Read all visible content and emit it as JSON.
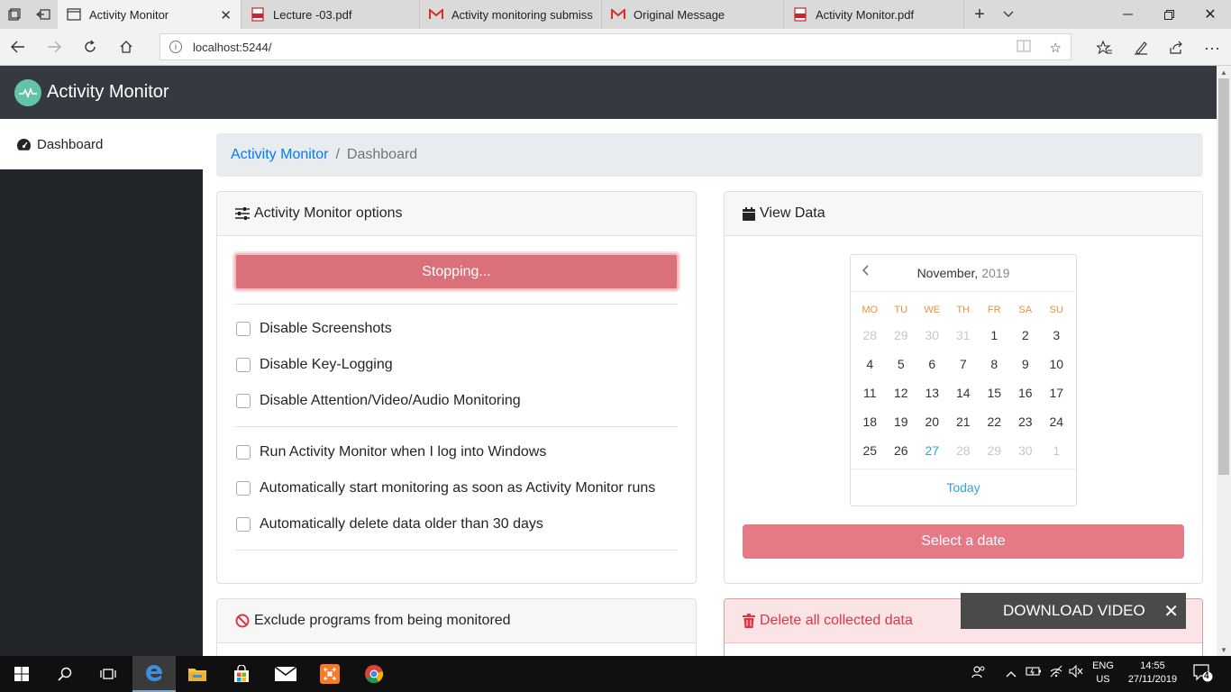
{
  "browser": {
    "tabs": [
      {
        "title": "Activity Monitor",
        "active": true,
        "icon": "page-icon"
      },
      {
        "title": "Lecture -03.pdf",
        "icon": "pdf-icon"
      },
      {
        "title": "Activity monitoring submiss",
        "icon": "gmail-icon"
      },
      {
        "title": "Original Message",
        "icon": "gmail-icon"
      },
      {
        "title": "Activity Monitor.pdf",
        "icon": "pdf-icon"
      }
    ],
    "url": "localhost:5244/"
  },
  "app": {
    "brand": "Activity Monitor",
    "brand_color": "#62c3a6",
    "navbar_color": "#343a40"
  },
  "sidebar": {
    "items": [
      {
        "label": "Dashboard",
        "icon": "dashboard-icon"
      }
    ]
  },
  "breadcrumb": {
    "link": "Activity Monitor",
    "separator": "/",
    "current": "Dashboard"
  },
  "options_card": {
    "title": "Activity Monitor options",
    "status_button": "Stopping...",
    "checkboxes_group1": [
      {
        "label": "Disable Screenshots",
        "checked": false
      },
      {
        "label": "Disable Key-Logging",
        "checked": false
      },
      {
        "label": "Disable Attention/Video/Audio Monitoring",
        "checked": false
      }
    ],
    "checkboxes_group2": [
      {
        "label": "Run Activity Monitor when I log into Windows",
        "checked": false
      },
      {
        "label": "Automatically start monitoring as soon as Activity Monitor runs",
        "checked": false
      },
      {
        "label": "Automatically delete data older than 30 days",
        "checked": false
      }
    ]
  },
  "view_card": {
    "title": "View Data",
    "calendar": {
      "month": "November,",
      "year": "2019",
      "weekdays": [
        "MO",
        "TU",
        "WE",
        "TH",
        "FR",
        "SA",
        "SU"
      ],
      "weeks": [
        [
          "28",
          "29",
          "30",
          "31",
          "1",
          "2",
          "3"
        ],
        [
          "4",
          "5",
          "6",
          "7",
          "8",
          "9",
          "10"
        ],
        [
          "11",
          "12",
          "13",
          "14",
          "15",
          "16",
          "17"
        ],
        [
          "18",
          "19",
          "20",
          "21",
          "22",
          "23",
          "24"
        ],
        [
          "25",
          "26",
          "27",
          "28",
          "29",
          "30",
          "1"
        ]
      ],
      "today_label": "Today",
      "today_day": "27"
    },
    "select_button": "Select a date"
  },
  "exclude_card": {
    "title": "Exclude programs from being monitored"
  },
  "delete_card": {
    "title": "Delete all collected data"
  },
  "overlay": {
    "download_video": "DOWNLOAD VIDEO"
  },
  "taskbar": {
    "lang_top": "ENG",
    "lang_bottom": "US",
    "time": "14:55",
    "date": "27/11/2019",
    "notifications": "4"
  }
}
